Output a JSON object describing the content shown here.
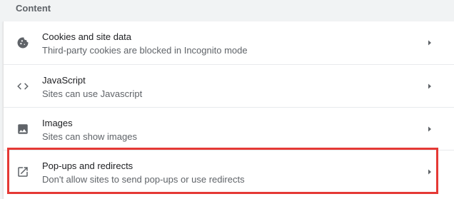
{
  "section": {
    "title": "Content"
  },
  "rows": [
    {
      "label": "Cookies and site data",
      "sub": "Third-party cookies are blocked in Incognito mode",
      "icon": "cookie-icon"
    },
    {
      "label": "JavaScript",
      "sub": "Sites can use Javascript",
      "icon": "code-brackets-icon"
    },
    {
      "label": "Images",
      "sub": "Sites can show images",
      "icon": "image-icon"
    },
    {
      "label": "Pop-ups and redirects",
      "sub": "Don't allow sites to send pop-ups or use redirects",
      "icon": "open-in-new-icon"
    }
  ],
  "colors": {
    "background": "#f1f3f4",
    "card": "#ffffff",
    "primary_text": "#202124",
    "secondary_text": "#5f6368",
    "highlight": "#e53935"
  }
}
